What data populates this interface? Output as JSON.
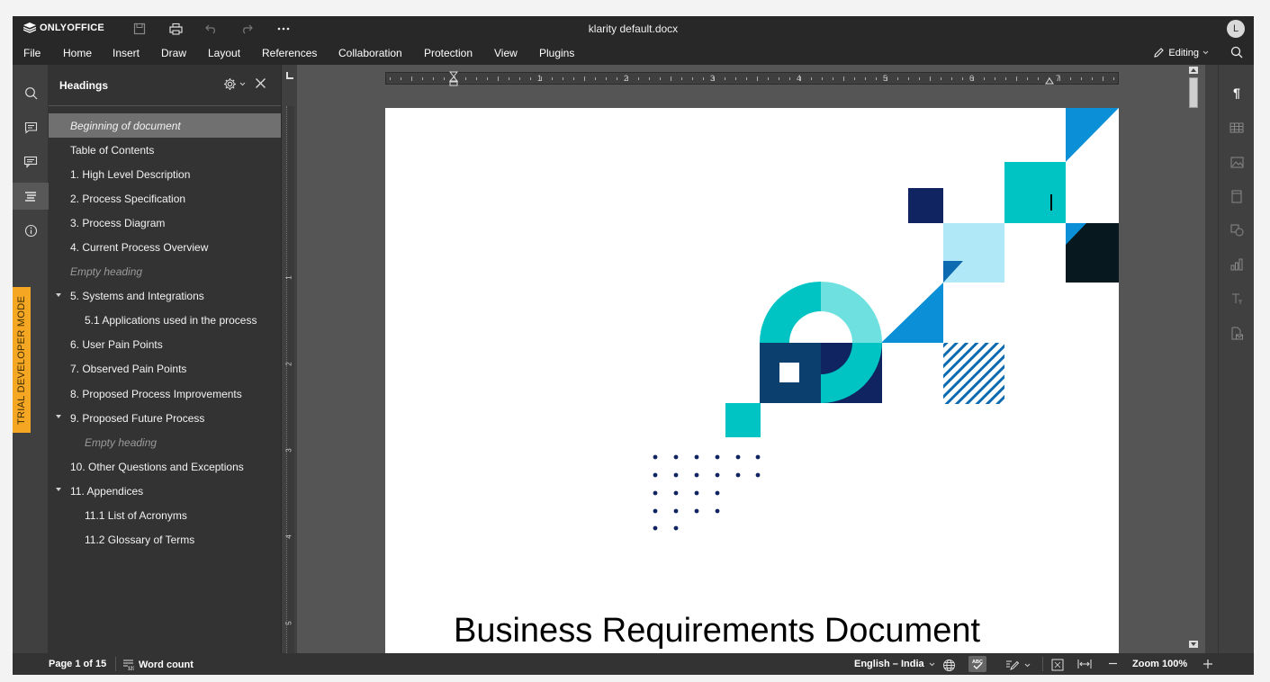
{
  "app": {
    "brand": "ONLYOFFICE",
    "doc_title": "klarity default.docx",
    "user_initial": "L"
  },
  "menu": [
    "File",
    "Home",
    "Insert",
    "Draw",
    "Layout",
    "References",
    "Collaboration",
    "Protection",
    "View",
    "Plugins"
  ],
  "mode": {
    "label": "Editing"
  },
  "trial_label": "TRIAL DEVELOPER MODE",
  "headings_panel": {
    "title": "Headings",
    "items": [
      {
        "label": "Beginning of document",
        "level": 1
      },
      {
        "label": "Table of Contents",
        "level": 1
      },
      {
        "label": "1. High Level Description",
        "level": 1
      },
      {
        "label": "2. Process Specification",
        "level": 1
      },
      {
        "label": "3. Process Diagram",
        "level": 1
      },
      {
        "label": "4. Current Process Overview",
        "level": 1
      },
      {
        "label": "Empty heading",
        "level": 1
      },
      {
        "label": "5. Systems and Integrations",
        "level": 1
      },
      {
        "label": "5.1  Applications used in the process",
        "level": 2
      },
      {
        "label": "6. User Pain Points",
        "level": 1
      },
      {
        "label": "7. Observed Pain Points",
        "level": 1
      },
      {
        "label": "8. Proposed Process Improvements",
        "level": 1
      },
      {
        "label": "9. Proposed Future Process",
        "level": 1
      },
      {
        "label": "Empty heading",
        "level": 2
      },
      {
        "label": "10. Other Questions and Exceptions",
        "level": 1
      },
      {
        "label": "11. Appendices",
        "level": 1
      },
      {
        "label": "11.1  List of Acronyms",
        "level": 2
      },
      {
        "label": "11.2  Glossary of Terms",
        "level": 2
      }
    ]
  },
  "ruler": {
    "h_numbers": [
      "1",
      "2",
      "3",
      "4",
      "5",
      "6",
      "7"
    ],
    "v_numbers": [
      "1",
      "2",
      "3",
      "4",
      "5"
    ]
  },
  "document": {
    "heading": "Business Requirements Document"
  },
  "status": {
    "page": "Page 1 of 15",
    "word_count": "Word count",
    "language": "English – India",
    "zoom": "Zoom 100%"
  },
  "colors": {
    "teal": "#00c4c4",
    "light_teal": "#6fe0e0",
    "navy": "#0f2461",
    "blue": "#0b8fd6",
    "pale_blue": "#b1e8f7",
    "dark": "#07181f",
    "trial": "#f5a623"
  }
}
